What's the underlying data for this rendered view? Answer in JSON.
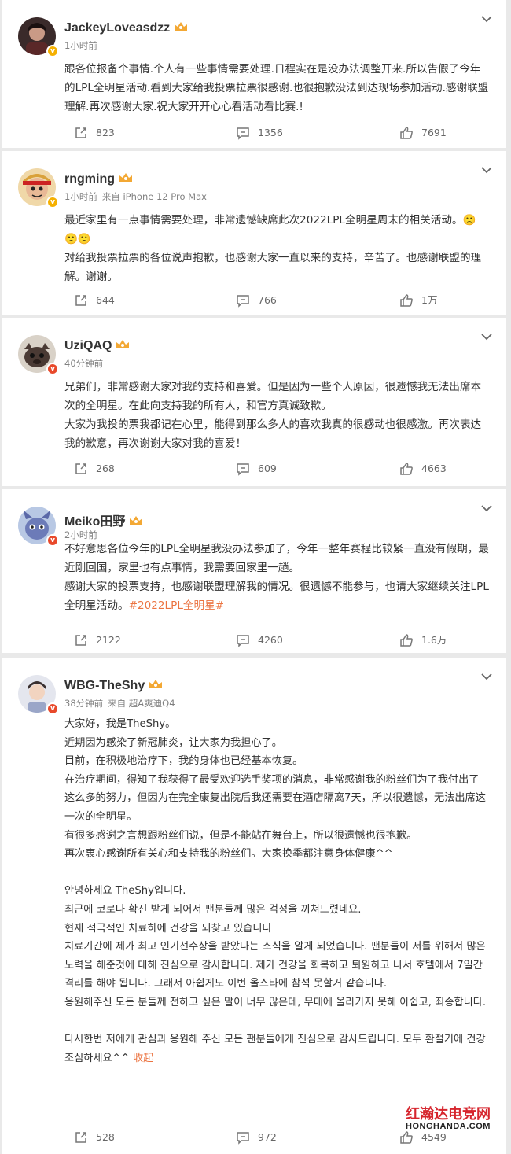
{
  "posts": [
    {
      "name": "JackeyLoveasdzz",
      "time": "1小时前",
      "source": "",
      "badge": "gold",
      "paragraphs": [
        "跟各位报备个事情.个人有一些事情需要处理.日程实在是没办法调整开来.所以告假了今年的LPL全明星活动.看到大家给我投票拉票很感谢.也很抱歉没法到达现场参加活动.感谢联盟理解.再次感谢大家.祝大家开开心心看活动看比赛.!"
      ],
      "repost": "823",
      "comment": "1356",
      "like": "7691"
    },
    {
      "name": "rngming",
      "time": "1小时前",
      "source": "来自 iPhone 12 Pro Max",
      "badge": "gold",
      "paragraphs": [
        "最近家里有一点事情需要处理，非常遗憾缺席此次2022LPL全明星周末的相关活动。🙁",
        "🙁🙁",
        "对给我投票拉票的各位说声抱歉，也感谢大家一直以来的支持，辛苦了。也感谢联盟的理解。谢谢。"
      ],
      "repost": "644",
      "comment": "766",
      "like": "1万"
    },
    {
      "name": "UziQAQ",
      "time": "40分钟前",
      "source": "",
      "badge": "red",
      "paragraphs": [
        "兄弟们，非常感谢大家对我的支持和喜爱。但是因为一些个人原因，很遗憾我无法出席本次的全明星。在此向支持我的所有人，和官方真诚致歉。",
        "大家为我投的票我都记在心里，能得到那么多人的喜欢我真的很感动也很感激。再次表达我的歉意，再次谢谢大家对我的喜爱！"
      ],
      "repost": "268",
      "comment": "609",
      "like": "4663"
    },
    {
      "name": "Meiko田野",
      "time": "2小时前",
      "source": "",
      "badge": "red",
      "paragraphs": [
        "不好意思各位今年的LPL全明星我没办法参加了，今年一整年赛程比较紧一直没有假期，最近刚回国，家里也有点事情，我需要回家里一趟。",
        "感谢大家的投票支持，也感谢联盟理解我的情况。很遗憾不能参与，也请大家继续关注LPL全明星活动。"
      ],
      "topic": "#2022LPL全明星#",
      "repost": "2122",
      "comment": "4260",
      "like": "1.6万"
    },
    {
      "name": "WBG-TheShy",
      "time": "38分钟前",
      "source": "来自 超A爽迪Q4",
      "badge": "red",
      "paragraphs": [
        "大家好，我是TheShy。",
        "近期因为感染了新冠肺炎，让大家为我担心了。",
        "目前，在积极地治疗下，我的身体也已经基本恢复。",
        "在治疗期间，得知了我获得了最受欢迎选手奖项的消息，非常感谢我的粉丝们为了我付出了这么多的努力，但因为在完全康复出院后我还需要在酒店隔离7天，所以很遗憾，无法出席这一次的全明星。",
        "有很多感谢之言想跟粉丝们说，但是不能站在舞台上，所以很遗憾也很抱歉。",
        "再次衷心感谢所有关心和支持我的粉丝们。大家换季都注意身体健康^^",
        "",
        "안녕하세요 TheShy입니다.",
        "최근에 코로나 확진 받게 되어서 팬분들께 많은 걱정을 끼쳐드렸네요.",
        "현재 적극적인 치료하에 건강을 되찾고 있습니다",
        "치료기간에 제가 최고 인기선수상을 받았다는 소식을 알게 되었습니다. 팬분들이 저를 위해서 많은 노력을 해준것에 대해 진심으로 감사합니다. 제가 건강을 회복하고 퇴원하고 나서 호텔에서 7일간 격리를 해야 됩니다. 그래서 아쉽게도 이번 올스타에 참석 못할거 같습니다.",
        "응원해주신 모든 분들께 전하고 싶은 말이 너무 많은데, 무대에 올라가지 못해 아쉽고, 죄송합니다.",
        "",
        "다시한번 저에게 관심과 응원해 주신 모든 팬분들에게 진심으로 감사드립니다. 모두 환절기에 건강 조심하세요^^"
      ],
      "fold": "收起",
      "repost": "528",
      "comment": "972",
      "like": "4549"
    }
  ],
  "watermark": {
    "cn": "红瀚达电竞网",
    "en": "HONGHANDA.COM"
  },
  "colors": {
    "accent": "#eb7340",
    "meta": "#808080",
    "page_bg": "#e9e9e9"
  },
  "icons": [
    "chevron-down-icon",
    "repost-icon",
    "comment-icon",
    "like-icon",
    "crown-icon",
    "verified-icon"
  ]
}
